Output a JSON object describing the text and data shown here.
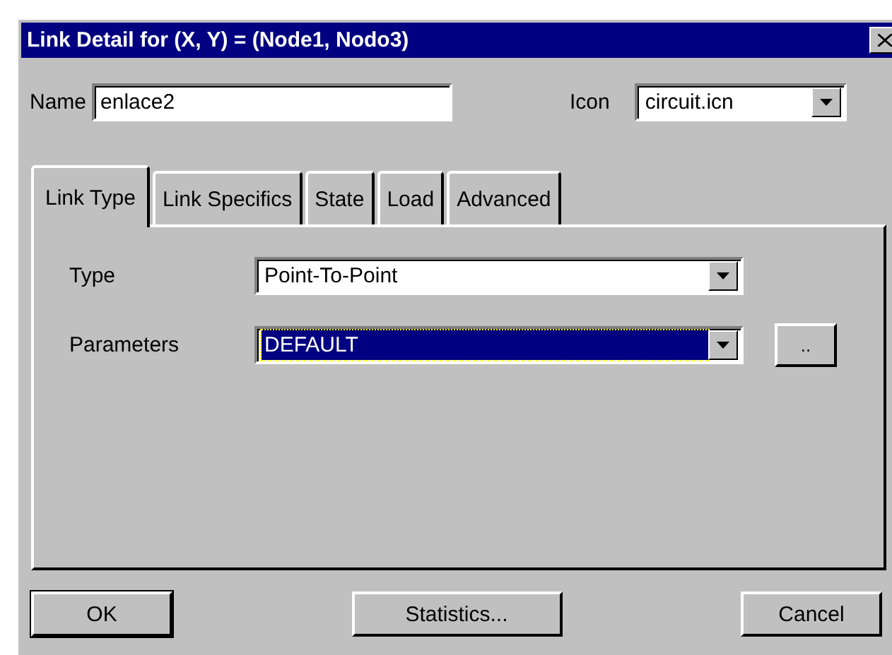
{
  "window": {
    "title": "Link Detail for (X, Y) = (Node1, Nodo3)"
  },
  "name": {
    "label": "Name",
    "value": "enlace2"
  },
  "icon": {
    "label": "Icon",
    "value": "circuit.icn"
  },
  "tabs": [
    {
      "label": "Link Type",
      "selected": true
    },
    {
      "label": "Link Specifics",
      "selected": false
    },
    {
      "label": "State",
      "selected": false
    },
    {
      "label": "Load",
      "selected": false
    },
    {
      "label": "Advanced",
      "selected": false
    }
  ],
  "fields": [
    {
      "label": "Type",
      "value": "Point-To-Point",
      "selected": false
    },
    {
      "label": "Parameters",
      "value": "DEFAULT",
      "selected": true,
      "button": ".."
    }
  ],
  "buttons": [
    {
      "label": "OK",
      "default": true
    },
    {
      "label": "Statistics...",
      "default": false
    },
    {
      "label": "Cancel",
      "default": false
    }
  ]
}
